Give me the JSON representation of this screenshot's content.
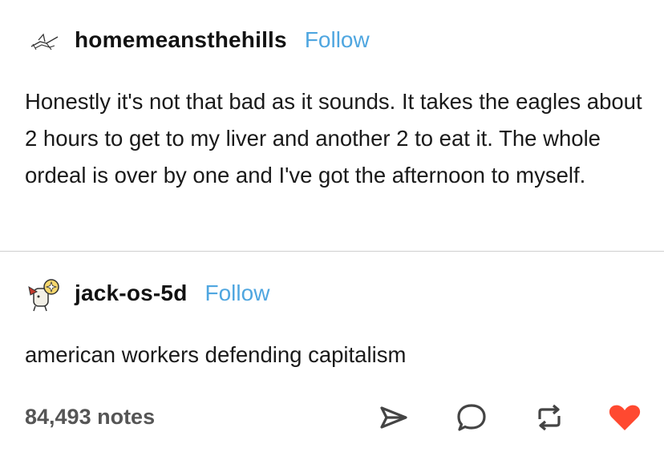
{
  "posts": [
    {
      "username": "homemeansthehills",
      "follow_label": "Follow",
      "text": "Honestly it's not that bad as it sounds. It takes the eagles about 2 hours to get to my liver and another 2 to eat it. The whole ordeal is over by one and I've got the afternoon to myself."
    },
    {
      "username": "jack-os-5d",
      "follow_label": "Follow",
      "text": "american workers defending capitalism"
    }
  ],
  "footer": {
    "notes": "84,493 notes",
    "icons": [
      "share-icon",
      "reply-icon",
      "reblog-icon",
      "like-icon"
    ]
  },
  "colors": {
    "follow": "#4fa6e0",
    "like": "#ff4930",
    "divider": "#cfcfcf"
  }
}
